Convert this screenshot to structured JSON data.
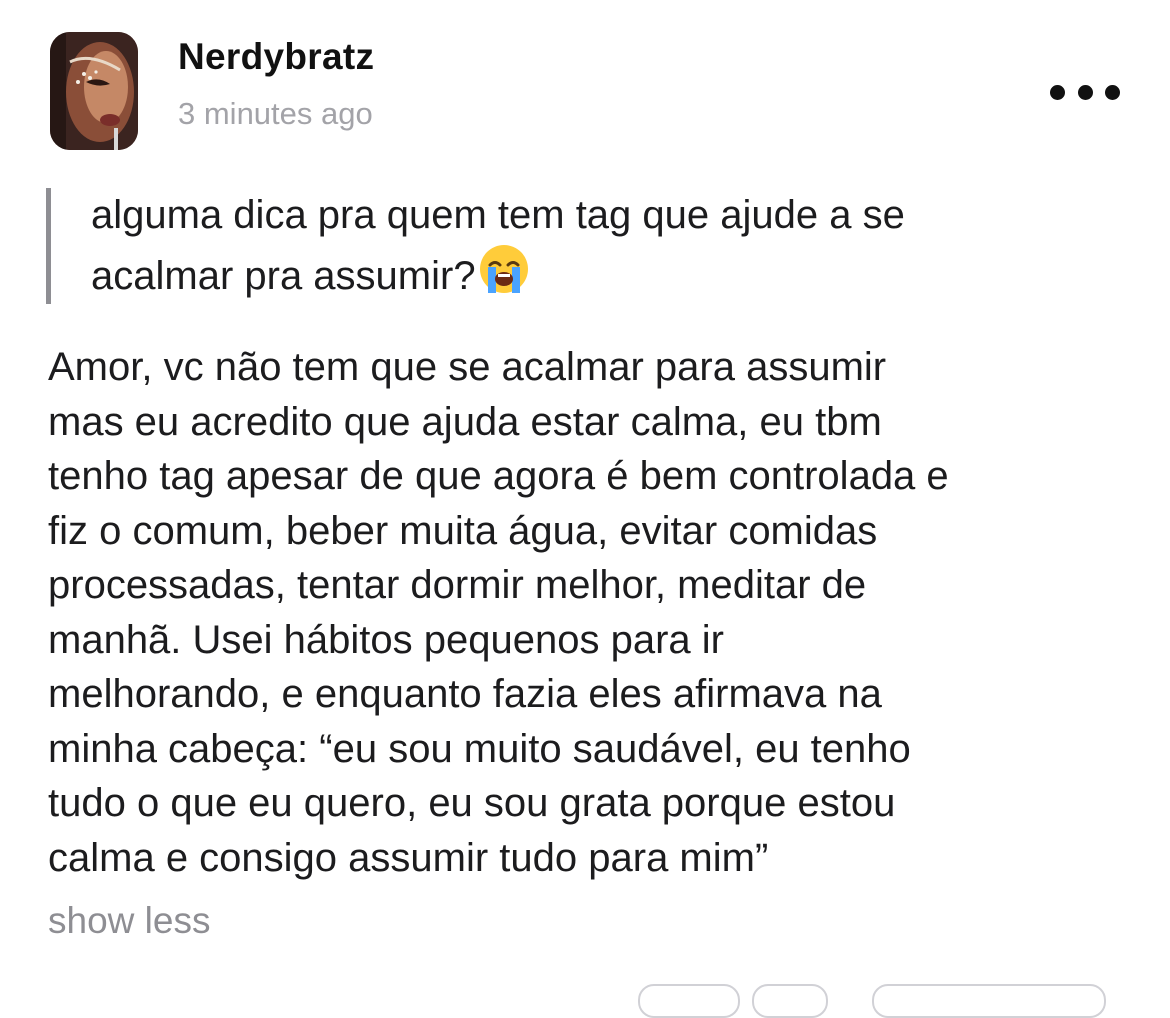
{
  "post": {
    "author": "Nerdybratz",
    "time": "3 minutes ago",
    "quote_lines": [
      "alguma dica pra quem tem tag que ajude a se",
      "acalmar pra assumir?"
    ],
    "quote_emoji": "loudly-crying-face",
    "body_lines": [
      "Amor, vc não tem que se acalmar para assumir",
      "mas eu acredito que ajuda estar calma, eu tbm",
      "tenho tag apesar de que agora é bem controlada e",
      "fiz o comum, beber muita água, evitar comidas",
      "processadas, tentar dormir melhor, meditar de",
      "manhã. Usei hábitos pequenos para ir",
      "melhorando, e enquanto fazia eles afirmava na",
      "minha cabeça: “eu sou muito saudável, eu tenho",
      "tudo o que eu quero, eu sou grata porque estou",
      "calma e consigo assumir tudo para mim”"
    ],
    "show_less_label": "show less"
  },
  "icons": {
    "more": "more-options-icon"
  },
  "colors": {
    "text": "#1c1c1e",
    "muted": "#a3a3a8",
    "quote_bar": "#8e8e93"
  }
}
